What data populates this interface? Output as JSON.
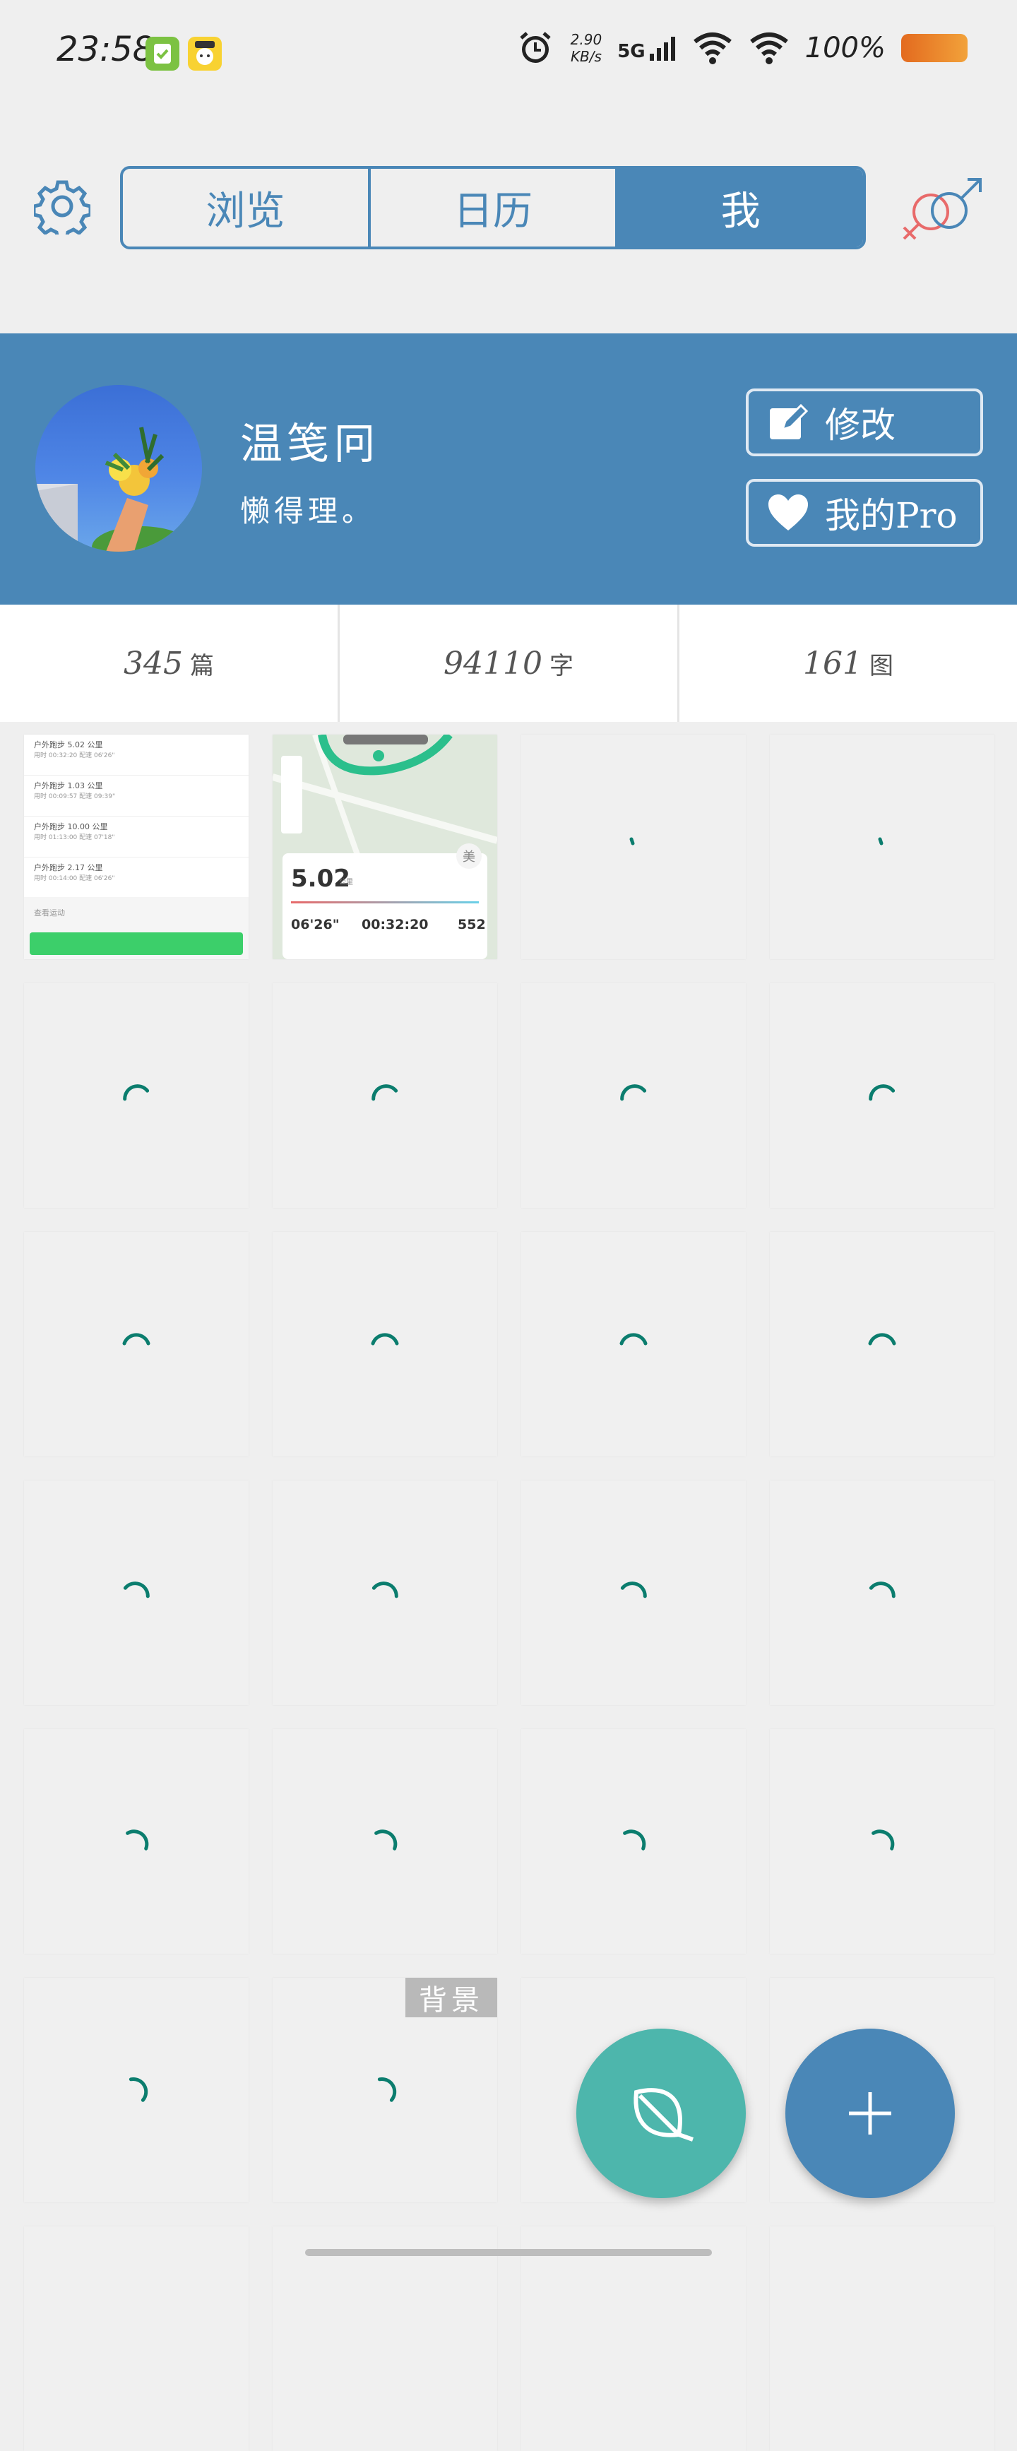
{
  "status_bar": {
    "time": "23:58",
    "net_speed_value": "2.90",
    "net_speed_unit": "KB/s",
    "network": "5G",
    "battery": "100%"
  },
  "nav": {
    "tabs": [
      {
        "label": "浏览",
        "active": false
      },
      {
        "label": "日历",
        "active": false
      },
      {
        "label": "我",
        "active": true
      }
    ]
  },
  "profile": {
    "name": "温笺冋",
    "bio": "懒得理。",
    "edit_label": "修改",
    "pro_label": "我的Pro"
  },
  "stats": [
    {
      "value": "345",
      "unit": "篇"
    },
    {
      "value": "94110",
      "unit": "字"
    },
    {
      "value": "161",
      "unit": "图"
    }
  ],
  "thumb1": {
    "rows": [
      {
        "title": "户外跑步 5.02 公里",
        "meta": "用时 00:32:20  配速 06'26\"",
        "date": ""
      },
      {
        "title": "户外跑步 1.03 公里",
        "meta": "用时 00:09:57  配速 09:39\"",
        "date": ""
      },
      {
        "title": "户外跑步 10.00 公里",
        "meta": "用时 01:13:00  配速 07'18\"",
        "date": ""
      },
      {
        "title": "户外跑步 2.17 公里",
        "meta": "用时 00:14:00  配速 06'26\"",
        "date": ""
      }
    ],
    "footer": "查看运动"
  },
  "thumb2": {
    "badge": "美",
    "distance": "5.02",
    "distance_unit": "公里",
    "pace": "06'26\"",
    "duration": "00:32:20",
    "steps": "552"
  },
  "tag_label": "背景",
  "colors": {
    "primary": "#4a87b7",
    "fab_green": "#4db6ac",
    "spinner": "#0b7d6e"
  }
}
